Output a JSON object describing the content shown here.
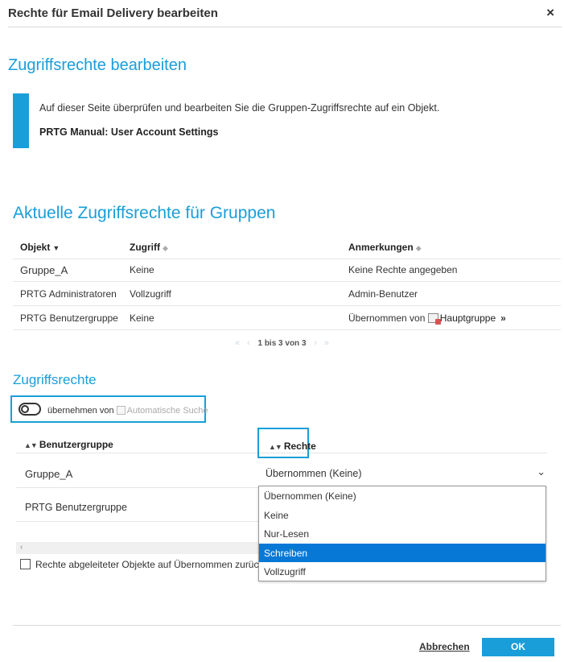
{
  "dialog": {
    "title": "Rechte für Email Delivery bearbeiten",
    "close_symbol": "×"
  },
  "section": {
    "title": "Zugriffsrechte bearbeiten",
    "info_text": "Auf dieser Seite überprüfen und bearbeiten Sie die Gruppen-Zugriffsrechte auf ein Objekt.",
    "manual_link": "PRTG Manual: User Account Settings"
  },
  "groups": {
    "title": "Aktuelle Zugriffsrechte für Gruppen",
    "columns": [
      "Objekt",
      "Zugriff",
      "Anmerkungen"
    ],
    "rows": [
      {
        "object": "Gruppe_A",
        "access": "Keine",
        "remarks": "Keine Rechte angegeben"
      },
      {
        "object": "PRTG Administratoren",
        "access": "Vollzugriff",
        "remarks": "Admin-Benutzer"
      },
      {
        "object": "PRTG Benutzergruppe",
        "access": "Keine",
        "remarks_prefix": "Übernommen von",
        "remarks_link": "Hauptgruppe",
        "remarks_suffix": "»"
      }
    ],
    "pager": {
      "first": "«",
      "prev": "‹",
      "text": "1 bis 3 von 3",
      "next": "›",
      "last": "»"
    }
  },
  "access": {
    "title": "Zugriffsrechte",
    "inherit_label": "übernehmen von",
    "inherit_source": "Automatische Suche",
    "col_group": "Benutzergruppe",
    "col_rights": "Rechte",
    "rows": [
      {
        "group": "Gruppe_A",
        "rights": "Übernommen (Keine)"
      },
      {
        "group": "PRTG Benutzergruppe",
        "rights": ""
      }
    ],
    "dropdown_options": [
      "Übernommen (Keine)",
      "Keine",
      "Nur-Lesen",
      "Schreiben",
      "Vollzugriff"
    ],
    "dropdown_highlighted": "Schreiben",
    "reset_label": "Rechte abgeleiteter Objekte auf Übernommen zurücksetzen"
  },
  "footer": {
    "cancel": "Abbrechen",
    "ok": "OK"
  },
  "colors": {
    "accent": "#1a9ed9",
    "dropdown_highlight": "#0878d6"
  }
}
